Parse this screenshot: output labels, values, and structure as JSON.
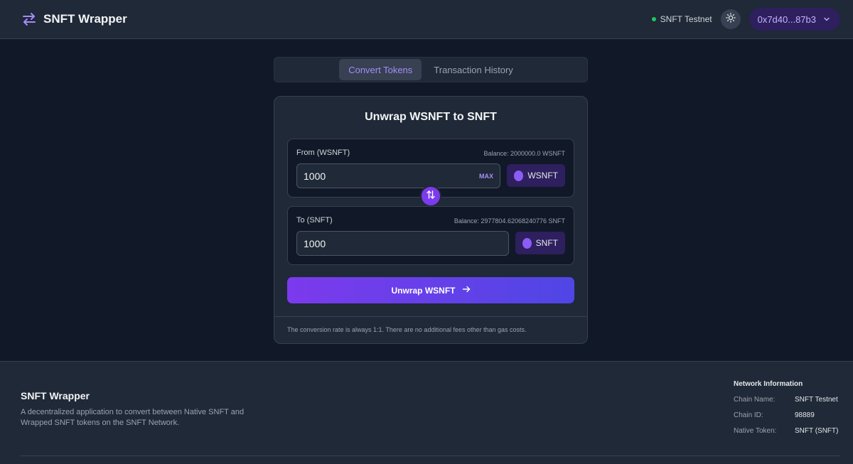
{
  "header": {
    "brand_title": "SNFT Wrapper",
    "network_label": "SNFT Testnet",
    "wallet_address": "0x7d40...87b3"
  },
  "tabs": [
    {
      "label": "Convert Tokens",
      "active": true
    },
    {
      "label": "Transaction History",
      "active": false
    }
  ],
  "card": {
    "title": "Unwrap WSNFT to SNFT",
    "from": {
      "label": "From (WSNFT)",
      "balance": "Balance: 2000000.0 WSNFT",
      "amount": "1000",
      "max_label": "MAX",
      "token": "WSNFT"
    },
    "to": {
      "label": "To (SNFT)",
      "balance": "Balance: 2977804.62068240776 SNFT",
      "amount": "1000",
      "token": "SNFT"
    },
    "action_label": "Unwrap WSNFT",
    "footer_note": "The conversion rate is always 1:1. There are no additional fees other than gas costs."
  },
  "footer": {
    "title": "SNFT Wrapper",
    "description": "A decentralized application to convert between Native SNFT and Wrapped SNFT tokens on the SNFT Network.",
    "network_info": {
      "title": "Network Information",
      "rows": [
        {
          "key": "Chain Name:",
          "value": "SNFT Testnet"
        },
        {
          "key": "Chain ID:",
          "value": "98889"
        },
        {
          "key": "Native Token:",
          "value": "SNFT (SNFT)"
        }
      ]
    }
  },
  "colors": {
    "accent": "#8b5cf6",
    "status_online": "#22c55e",
    "background": "#111827",
    "surface": "#1f2937"
  },
  "icons": {
    "brand": "swap-arrows-icon",
    "theme": "sun-icon",
    "wallet": "chevron-down-icon",
    "swap": "swap-vertical-icon",
    "action": "arrow-right-icon"
  }
}
